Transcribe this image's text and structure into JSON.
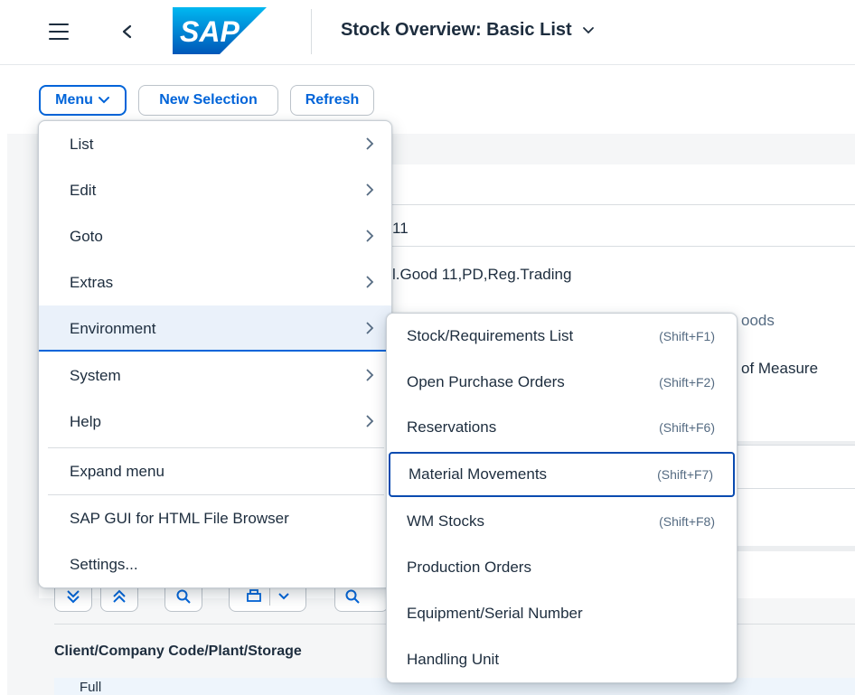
{
  "header": {
    "title": "Stock Overview: Basic List",
    "logo_text": "SAP"
  },
  "toolbar": {
    "menu_label": "Menu",
    "new_selection_label": "New Selection",
    "refresh_label": "Refresh"
  },
  "background": {
    "field_value_1": "11",
    "field_value_2": "l.Good 11,PD,Reg.Trading",
    "label_goods": "oods",
    "label_measure": "of Measure",
    "table_header": "Client/Company Code/Plant/Storage",
    "row_text": "Full"
  },
  "menu": {
    "items": [
      {
        "label": "List"
      },
      {
        "label": "Edit"
      },
      {
        "label": "Goto"
      },
      {
        "label": "Extras"
      },
      {
        "label": "Environment"
      },
      {
        "label": "System"
      },
      {
        "label": "Help"
      },
      {
        "label": "Expand menu"
      },
      {
        "label": "SAP GUI for HTML File Browser"
      },
      {
        "label": "Settings..."
      }
    ]
  },
  "submenu": {
    "items": [
      {
        "label": "Stock/Requirements List",
        "shortcut": "(Shift+F1)"
      },
      {
        "label": "Open Purchase Orders",
        "shortcut": "(Shift+F2)"
      },
      {
        "label": "Reservations",
        "shortcut": "(Shift+F6)"
      },
      {
        "label": "Material Movements",
        "shortcut": "(Shift+F7)"
      },
      {
        "label": "WM Stocks",
        "shortcut": "(Shift+F8)"
      },
      {
        "label": "Production Orders"
      },
      {
        "label": "Equipment/Serial Number"
      },
      {
        "label": "Handling Unit"
      }
    ]
  },
  "colors": {
    "accent": "#0064d9",
    "text": "#1d2d3e",
    "logo_blue": "#0a6ed1"
  },
  "icons": [
    "hamburger-icon",
    "back-icon",
    "chevron-down-icon",
    "chevron-right-icon",
    "expand-all-icon",
    "collapse-all-icon",
    "search-icon",
    "print-icon",
    "zoom-icon"
  ]
}
